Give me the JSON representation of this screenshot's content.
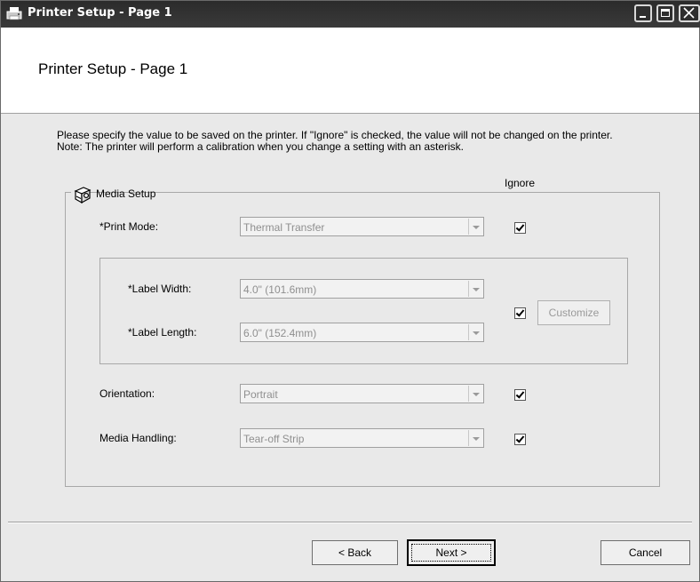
{
  "window": {
    "title": "Printer Setup - Page 1"
  },
  "header": {
    "title": "Printer Setup - Page 1"
  },
  "instructions": {
    "line1": "Please specify the value to be saved on the printer. If \"Ignore\" is checked, the value will not be changed on the printer.",
    "line2": "Note: The printer will perform a calibration when you change a setting with an asterisk."
  },
  "ignore_column_label": "Ignore",
  "media_setup": {
    "group_label": "Media Setup",
    "print_mode": {
      "label": "*Print Mode:",
      "value": "Thermal Transfer",
      "ignore": true
    },
    "label_width": {
      "label": "*Label Width:",
      "value": "4.0\" (101.6mm)"
    },
    "label_length": {
      "label": "*Label Length:",
      "value": "6.0\" (152.4mm)"
    },
    "label_size_ignore": true,
    "customize_label": "Customize",
    "orientation": {
      "label": "Orientation:",
      "value": "Portrait",
      "ignore": true
    },
    "media_handling": {
      "label": "Media Handling:",
      "value": "Tear-off Strip",
      "ignore": true
    }
  },
  "footer": {
    "back_label": "< Back",
    "next_label": "Next >",
    "cancel_label": "Cancel"
  },
  "colors": {
    "dialog_bg": "#e9e9e9",
    "titlebar_bg": "#2e2e2e",
    "header_bg": "#ffffff",
    "disabled_text": "#8f8f8f"
  }
}
